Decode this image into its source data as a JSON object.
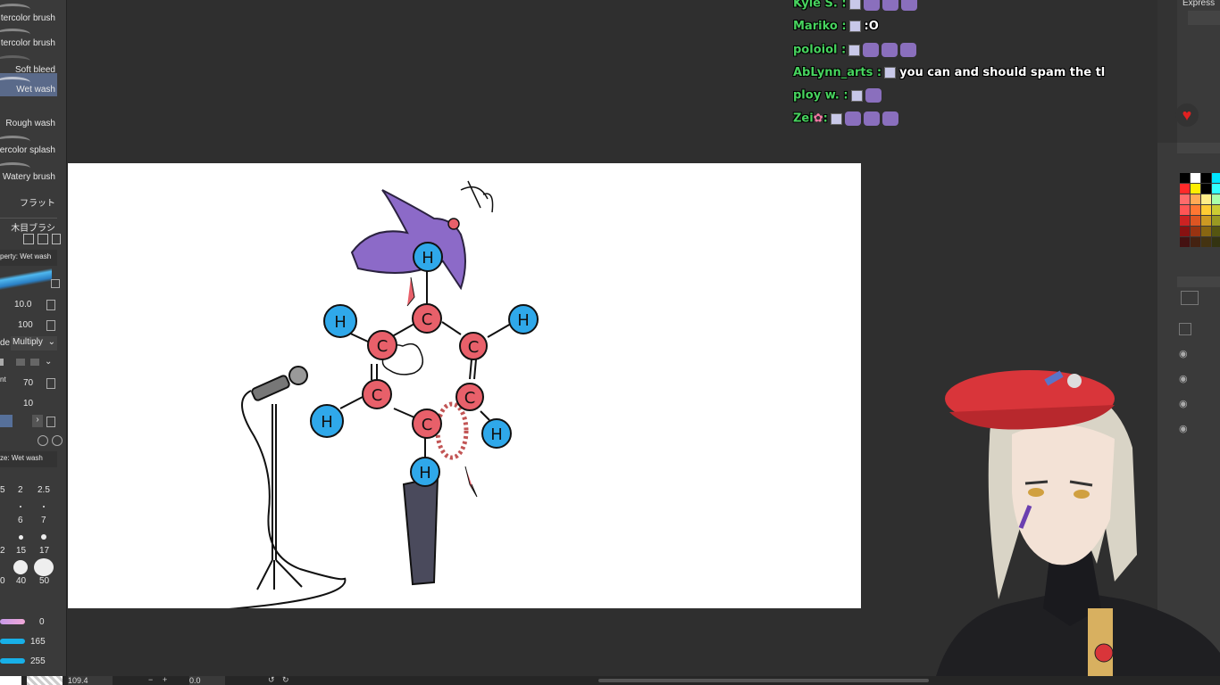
{
  "left_panel": {
    "brushes": [
      {
        "label": "tercolor brush"
      },
      {
        "label": "tercolor brush"
      },
      {
        "label": "Soft bleed"
      },
      {
        "label": "Wet wash"
      },
      {
        "label": "Rough wash"
      },
      {
        "label": "ercolor splash"
      },
      {
        "label": "Watery brush"
      },
      {
        "label": "フラット"
      }
    ],
    "group_label": "木目ブラシ",
    "property_title": "perty: Wet wash",
    "size_value": "10.0",
    "opacity_value": "100",
    "mode_label": "de",
    "blend_mode": "Multiply",
    "density_label": "nt",
    "density_value": "70",
    "spacing_value": "10",
    "size_palette_title": "ze: Wet wash",
    "sizes": [
      "5",
      "2",
      "2.5",
      "6",
      "7",
      "2",
      "15",
      "17",
      "0",
      "40",
      "50"
    ],
    "color_values": [
      "0",
      "165",
      "255"
    ]
  },
  "chat": [
    {
      "user": "Kyle S. :",
      "message": "",
      "emotes": 3,
      "badge": true
    },
    {
      "user": "Mariko :",
      "message": ":O",
      "emotes": 0,
      "badge": true
    },
    {
      "user": "poloiol :",
      "message": "",
      "emotes": 3,
      "badge": true
    },
    {
      "user": "AbLynn_arts :",
      "message": "you can and should spam the tl",
      "emotes": 0,
      "badge": true
    },
    {
      "user": "ploy w. :",
      "message": "",
      "emotes": 1,
      "badge": true
    },
    {
      "user": "Zei",
      "message": "",
      "emotes": 3,
      "badge": true
    }
  ],
  "right_panel": {
    "expression_label": "Express",
    "heart_icon": "heart-icon",
    "palette_colors": [
      "#000000",
      "#ffffff",
      "#000000",
      "#00e5ff",
      "#ff2a2a",
      "#ffee00",
      "#000000",
      "#33ffff",
      "#ff6b6b",
      "#ffaa55",
      "#ffee88",
      "#aaffaa",
      "#ff5555",
      "#ff7733",
      "#ffcc33",
      "#cccc33",
      "#cc2222",
      "#dd5522",
      "#cc9922",
      "#999922",
      "#881111",
      "#993311",
      "#886611",
      "#555511",
      "#441111",
      "#442211",
      "#443311",
      "#333311"
    ]
  },
  "molecule": {
    "atoms": [
      "H",
      "C",
      "C",
      "C",
      "C",
      "C",
      "C",
      "H",
      "H",
      "H",
      "H",
      "H"
    ]
  },
  "bottom_bar": {
    "zoom": "109.4",
    "rotation": "0.0"
  },
  "colors": {
    "chat_user": "#47d35e",
    "carbon": "#e8606a",
    "hydrogen": "#2fa8ea",
    "beret": "#d9353a",
    "hair": "#8c6ac8"
  }
}
